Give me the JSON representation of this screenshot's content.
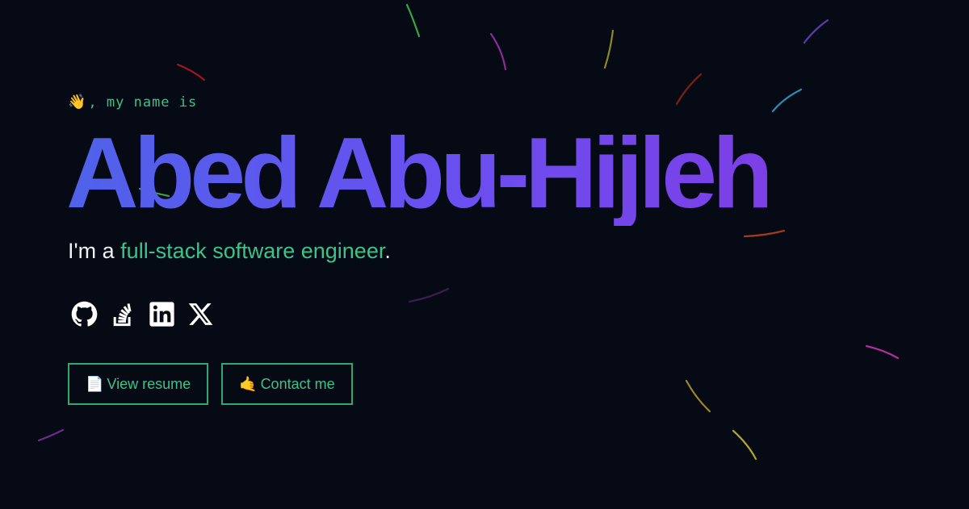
{
  "hero": {
    "greeting_icon": "👋",
    "greeting_text": ", my name is",
    "name": "Abed Abu-Hijleh",
    "tagline_prefix": "I'm a ",
    "tagline_role": "full-stack software engineer",
    "tagline_suffix": "."
  },
  "socials": [
    {
      "name": "github",
      "icon": "github-icon"
    },
    {
      "name": "stackoverflow",
      "icon": "stackoverflow-icon"
    },
    {
      "name": "linkedin",
      "icon": "linkedin-icon"
    },
    {
      "name": "x",
      "icon": "x-icon"
    }
  ],
  "buttons": {
    "resume_icon": "📄",
    "resume_label": "View resume",
    "contact_icon": "🤙",
    "contact_label": "Contact me"
  },
  "colors": {
    "background": "#050a14",
    "accent": "#3ec28a",
    "name_gradient_start": "#4f62ea",
    "name_gradient_end": "#7c3fe6",
    "text": "#eef0f3"
  }
}
